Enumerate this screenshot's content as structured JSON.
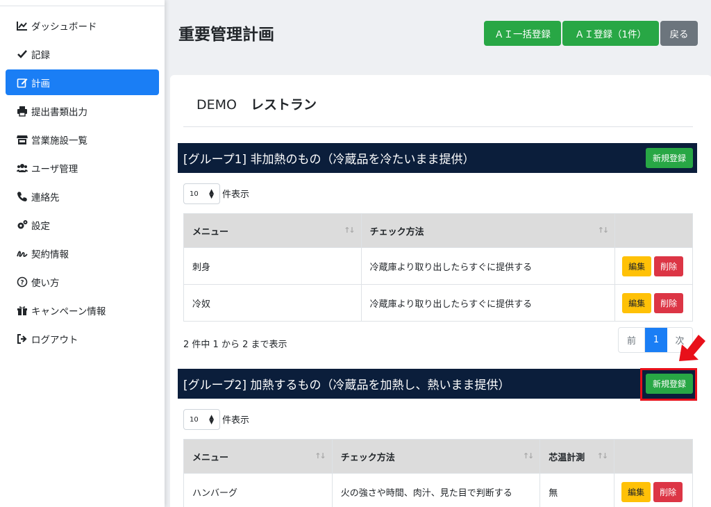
{
  "sidebar": {
    "items": [
      {
        "label": "ダッシュボード",
        "icon": "chart-line-icon"
      },
      {
        "label": "記録",
        "icon": "check-icon"
      },
      {
        "label": "計画",
        "icon": "edit-icon"
      },
      {
        "label": "提出書類出力",
        "icon": "printer-icon"
      },
      {
        "label": "営業施設一覧",
        "icon": "store-icon"
      },
      {
        "label": "ユーザ管理",
        "icon": "users-icon"
      },
      {
        "label": "連絡先",
        "icon": "phone-icon"
      },
      {
        "label": "設定",
        "icon": "gears-icon"
      },
      {
        "label": "契約情報",
        "icon": "signature-icon"
      },
      {
        "label": "使い方",
        "icon": "question-circle-icon"
      },
      {
        "label": "キャンペーン情報",
        "icon": "gift-icon"
      },
      {
        "label": "ログアウト",
        "icon": "logout-icon"
      }
    ],
    "active_label": "計画"
  },
  "header": {
    "title": "重要管理計画",
    "ai_bulk_label": "ＡＩ一括登録",
    "ai_single_label": "ＡＩ登録（1件）",
    "back_label": "戻る"
  },
  "restaurant": {
    "prefix": "DEMO",
    "name": "レストラン"
  },
  "group1": {
    "title": "[グループ1] 非加熱のもの（冷蔵品を冷たいまま提供）",
    "new_label": "新規登録",
    "length_value": "10",
    "length_suffix": "件表示",
    "columns": [
      "メニュー",
      "チェック方法"
    ],
    "rows": [
      {
        "menu": "刺身",
        "method": "冷蔵庫より取り出したらすぐに提供する"
      },
      {
        "menu": "冷奴",
        "method": "冷蔵庫より取り出したらすぐに提供する"
      }
    ],
    "edit_label": "編集",
    "delete_label": "削除",
    "info": "2 件中 1 から 2 まで表示",
    "pager": {
      "prev": "前",
      "current": "1",
      "next": "次"
    }
  },
  "group2": {
    "title": "[グループ2] 加熱するもの（冷蔵品を加熱し、熱いまま提供）",
    "new_label": "新規登録",
    "length_value": "10",
    "length_suffix": "件表示",
    "columns": [
      "メニュー",
      "チェック方法",
      "芯温計測"
    ],
    "rows": [
      {
        "menu": "ハンバーグ",
        "method": "火の強さや時間、肉汁、見た目で判断する",
        "temp": "無"
      }
    ],
    "edit_label": "編集",
    "delete_label": "削除"
  },
  "colors": {
    "primary": "#1a7ef5",
    "success": "#28a745",
    "warning": "#ffc107",
    "danger": "#dc3545",
    "header_bg": "#0b1e3b",
    "highlight": "#e8101a"
  }
}
